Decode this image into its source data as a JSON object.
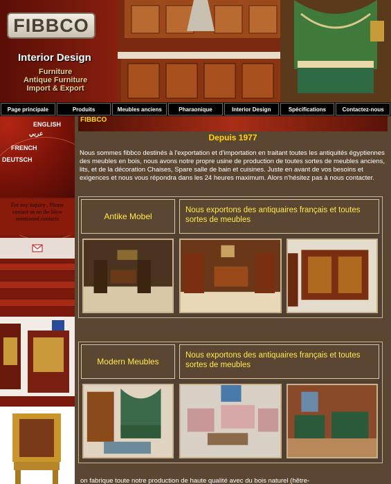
{
  "header": {
    "logo": "FIBBCO",
    "tagline": "Interior Design",
    "services": [
      "Furniture",
      "Antique Furniture",
      "Import & Export"
    ]
  },
  "nav": [
    "Page principale",
    "Produits",
    "Meubles anciens",
    "Pharaonique",
    "Interior Design",
    "Spécifications",
    "Contactez-nous"
  ],
  "languages": [
    "ENGLISH",
    "عربي",
    "FRENCH",
    "DEUTSCH"
  ],
  "sidebar": {
    "inquiry": "For any inquiry , Please contact us on the blow mentioned contacts"
  },
  "main": {
    "brand": "FIBBCO",
    "since": "Depuis 1977",
    "intro": "Nous sommes fibbco destinés à l'exportation et d'importation en traitant toutes les antiquités égyptiennes des meubles en bois, nous avons notre propre usine de production de toutes sortes de meubles anciens, lits, et de la décoration Chaises, Spare salle de bain et cuisines. Juste en avant de vos besoins et exigences et nous vous répondra dans les 24 heures maximum. Alors n'hésitez pas à nous contacter.",
    "sections": [
      {
        "title": "Antike Mobel",
        "desc": "Nous exportons des antiquaires français et toutes sortes de meubles"
      },
      {
        "title": "Modern Meubles",
        "desc": "Nous exportons des antiquaires français et toutes sortes de meubles"
      }
    ],
    "footer": "on fabrique toute notre production de haute qualité avec du bois naturel (hêtre-"
  },
  "colors": {
    "background": "#5b4632",
    "accent_yellow": "#ffea4d",
    "brand_red": "#8e2210"
  }
}
